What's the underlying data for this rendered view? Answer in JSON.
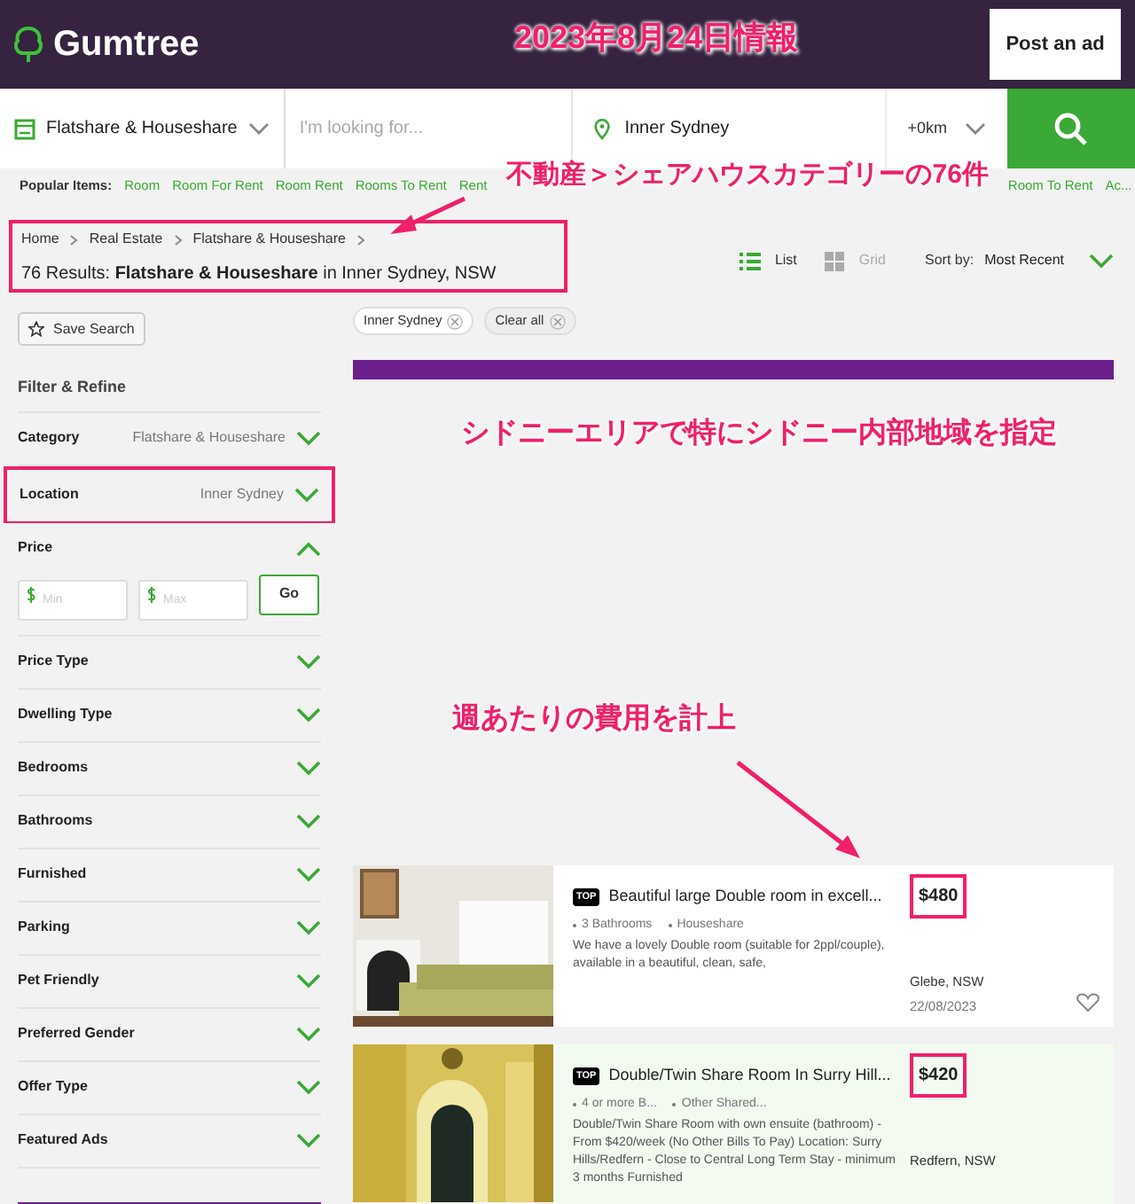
{
  "header": {
    "logo": "Gumtree",
    "post_button": "Post an ad"
  },
  "search": {
    "category": "Flatshare & Houseshare",
    "placeholder": "I'm looking for...",
    "location": "Inner Sydney",
    "radius": "+0km"
  },
  "popular": {
    "label": "Popular Items:",
    "items_before": [
      "Room",
      "Room For Rent",
      "Room Rent",
      "Rooms To Rent",
      "Rent"
    ],
    "items_after": [
      "Room To Rent",
      "Ac..."
    ]
  },
  "breadcrumbs": [
    "Home",
    "Real Estate",
    "Flatshare & Houseshare"
  ],
  "results_title": "76 Results: **Flatshare & Houseshare** in Inner Sydney, NSW",
  "view_options": [
    {
      "label": "List",
      "selected": true
    },
    {
      "label": "Grid",
      "selected": false
    }
  ],
  "sort": {
    "label": "Sort by:",
    "value": "Most Recent"
  },
  "save_search": "Save Search",
  "chips": [
    "Inner Sydney",
    "Clear all"
  ],
  "filters": {
    "title": "Filter & Refine",
    "items": [
      {
        "label": "Category",
        "value": "Flatshare & Houseshare",
        "expanded": false
      },
      {
        "label": "Location",
        "value": "Inner Sydney",
        "expanded": false
      },
      {
        "label": "Price",
        "expanded": true,
        "min_placeholder": "Min",
        "max_placeholder": "Max",
        "go": "Go"
      },
      {
        "label": "Price Type",
        "expanded": false
      },
      {
        "label": "Dwelling Type",
        "expanded": false
      },
      {
        "label": "Bedrooms",
        "expanded": false
      },
      {
        "label": "Bathrooms",
        "expanded": false
      },
      {
        "label": "Furnished",
        "expanded": false
      },
      {
        "label": "Parking",
        "expanded": false
      },
      {
        "label": "Pet Friendly",
        "expanded": false
      },
      {
        "label": "Preferred Gender",
        "expanded": false
      },
      {
        "label": "Offer Type",
        "expanded": false
      },
      {
        "label": "Featured Ads",
        "expanded": false
      }
    ]
  },
  "listings": [
    {
      "badge": "TOP",
      "title": "Beautiful large Double room in excell...",
      "price": "$480",
      "attributes": [
        "3 Bathrooms",
        "Houseshare"
      ],
      "description": "We have a lovely Double room (suitable for 2ppl/couple), available in a beautiful, clean, safe,",
      "location": "Glebe, NSW",
      "date": "22/08/2023",
      "highlighted": false
    },
    {
      "badge": "TOP",
      "title": "Double/Twin Share Room In Surry Hill...",
      "price": "$420",
      "attributes": [
        "4 or more B...",
        "Other Shared..."
      ],
      "description": "Double/Twin Share Room with own ensuite (bathroom) - From $420/week (No Other Bills To Pay) Location: Surry Hills/Redfern - Close to Central Long Term Stay - minimum 3 months Furnished",
      "location": "Redfern, NSW",
      "highlighted": true
    }
  ],
  "annotations": [
    "2023年8月24日情報",
    "不動産＞シェアハウスカテゴリーの76件",
    "シドニーエリアで特にシドニー内部地域を指定",
    "週あたりの費用を計上"
  ]
}
